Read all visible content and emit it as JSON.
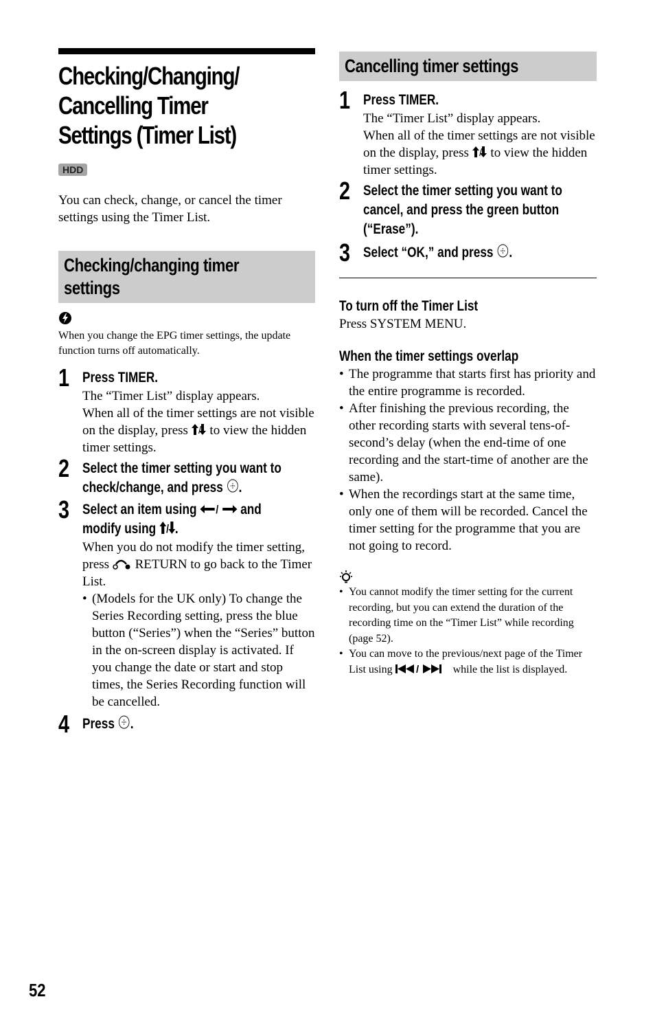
{
  "page": {
    "title": "Checking/Changing/ Cancelling Timer Settings (Timer List)",
    "title_lines": [
      "Checking/Changing/",
      "Cancelling Timer",
      "Settings (Timer List)"
    ],
    "badge": "HDD",
    "intro": "You can check, change, or cancel the timer settings using the Timer List.",
    "page_number": "52"
  },
  "checking_section": {
    "heading_lines": [
      "Checking/changing timer",
      "settings"
    ],
    "note_icon": "lightning-note-icon",
    "note": "When you change the EPG timer settings, the update function turns off automatically.",
    "steps": [
      {
        "num": "1",
        "head": "Press TIMER.",
        "body": [
          "The “Timer List” display appears.",
          "When all of the timer settings are not visible on the display, press",
          "to view the hidden timer settings."
        ]
      },
      {
        "num": "2",
        "head_lines": [
          "Select the timer setting you want to",
          "check/change, and press"
        ]
      },
      {
        "num": "3",
        "head_parts": [
          "Select an item using",
          "and",
          "modify using"
        ],
        "body_parts": [
          "When you do not modify the timer setting, press",
          "RETURN to go back to the Timer List."
        ],
        "bullet": "(Models for the UK only) To change the Series Recording setting, press the blue button (“Series”) when the “Series” button in the on-screen display is activated. If you change the date or start and stop times, the Series Recording function will be cancelled."
      },
      {
        "num": "4",
        "head": "Press"
      }
    ]
  },
  "cancelling_section": {
    "heading": "Cancelling timer settings",
    "steps": [
      {
        "num": "1",
        "head": "Press TIMER.",
        "body": [
          "The “Timer List” display appears.",
          "When all of the timer settings are not visible on the display, press",
          "to view the hidden timer settings."
        ]
      },
      {
        "num": "2",
        "head_lines": [
          "Select the timer setting you want to",
          "cancel, and press the green button",
          "(“Erase”)."
        ]
      },
      {
        "num": "3",
        "head": "Select “OK,” and press"
      }
    ]
  },
  "turn_off": {
    "heading": "To turn off the Timer List",
    "body": "Press SYSTEM MENU."
  },
  "overlap": {
    "heading": "When the timer settings overlap",
    "bullets": [
      "The programme that starts first has priority and the entire programme is recorded.",
      "After finishing the previous recording, the other recording starts with several tens-of-second’s delay (when the end-time of one recording and the start-time of another are the same).",
      "When the recordings start at the same time, only one of them will be recorded. Cancel the timer setting for the programme that you are not going to record."
    ]
  },
  "hints": {
    "icon": "lightbulb-hint-icon",
    "bullets": [
      "You cannot modify the timer setting for the current recording, but you can extend the duration of the recording time on the “Timer List” while recording (page 52).",
      {
        "before": "You can move to the previous/next page of the Timer List using",
        "after": "while the list is displayed."
      }
    ]
  },
  "symbols": {
    "slash": "/",
    "period": "."
  }
}
